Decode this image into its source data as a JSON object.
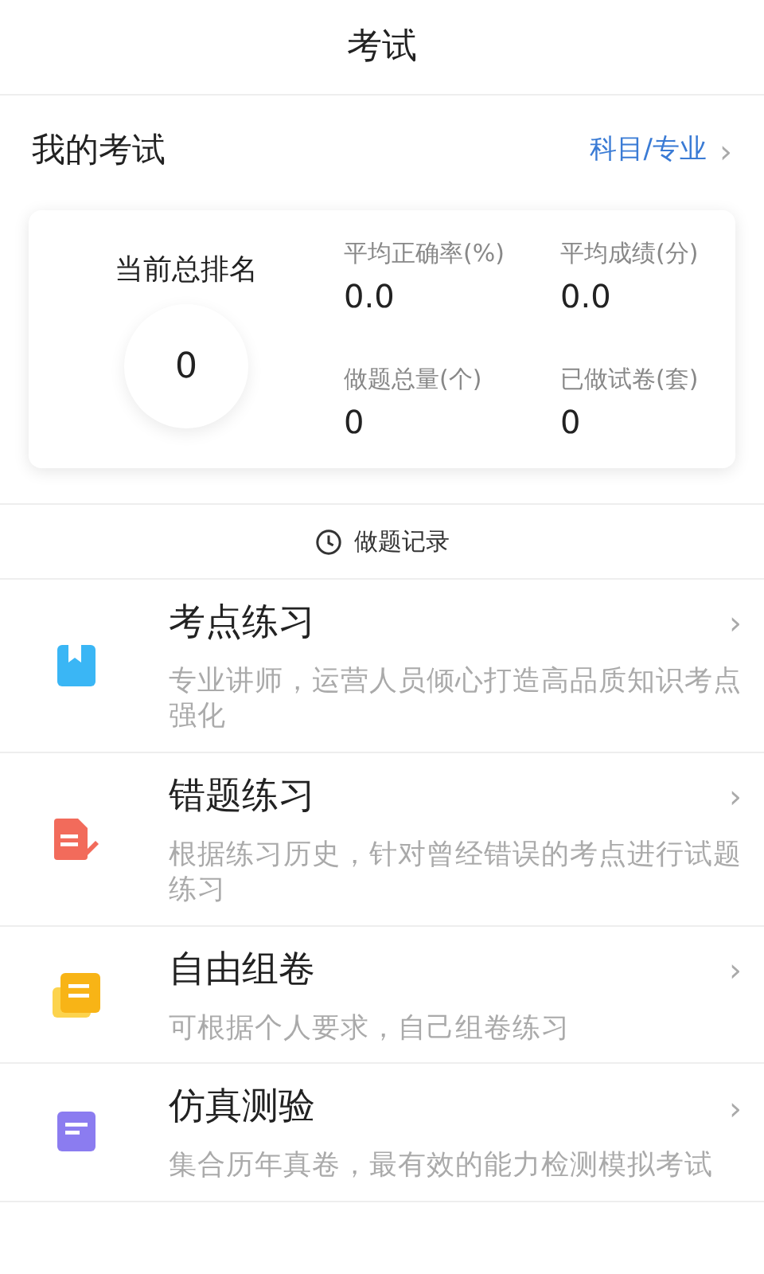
{
  "header": {
    "title": "考试"
  },
  "my_exam": {
    "title": "我的考试",
    "link": "科目/专业",
    "chevron": "›"
  },
  "stats": {
    "rank_label": "当前总排名",
    "rank_value": "0",
    "items": [
      {
        "label": "平均正确率(%)",
        "value": "0.0"
      },
      {
        "label": "平均成绩(分)",
        "value": "0.0"
      },
      {
        "label": "做题总量(个)",
        "value": "0"
      },
      {
        "label": "已做试卷(套)",
        "value": "0"
      }
    ]
  },
  "record_link": {
    "label": "做题记录"
  },
  "practice_items": [
    {
      "kind": "bookmark",
      "title": "考点练习",
      "description": "专业讲师，运营人员倾心打造高品质知识考点强化",
      "chevron": "›"
    },
    {
      "kind": "edit",
      "title": "错题练习",
      "description": "根据练习历史，针对曾经错误的考点进行试题练习",
      "chevron": "›"
    },
    {
      "kind": "paper",
      "title": "自由组卷",
      "description": "可根据个人要求，自己组卷练习",
      "chevron": "›"
    },
    {
      "kind": "doc",
      "title": "仿真测验",
      "description": "集合历年真卷，最有效的能力检测模拟考试",
      "chevron": "›"
    }
  ]
}
